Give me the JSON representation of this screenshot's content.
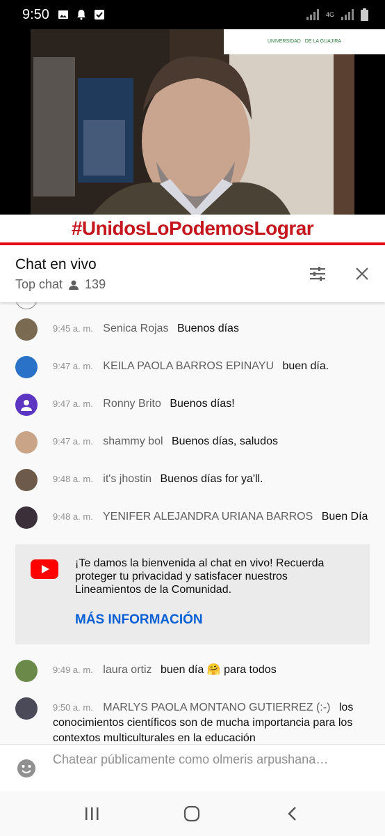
{
  "status_bar": {
    "time": "9:50",
    "network": "4G"
  },
  "video": {
    "hashtag": "#UnidosLoPodemosLograr",
    "logo_line1": "UNIVERSIDAD",
    "logo_line2": "DE LA GUAJIRA"
  },
  "chat_header": {
    "title": "Chat en vivo",
    "mode": "Top chat",
    "viewers": "139"
  },
  "messages": [
    {
      "time": "9:45 a. m.",
      "author": "Senica Rojas",
      "text": "Buenos días",
      "avatar_color": "#7a6a52"
    },
    {
      "time": "9:47 a. m.",
      "author": "KEILA PAOLA BARROS EPINAYU",
      "text": "buen día.",
      "avatar_color": "#2a72c8"
    },
    {
      "time": "9:47 a. m.",
      "author": "Ronny Brito",
      "text": "Buenos días!",
      "avatar_color": "#5c35c2"
    },
    {
      "time": "9:47 a. m.",
      "author": "shammy bol",
      "text": "Buenos días, saludos",
      "avatar_color": "#c9a487"
    },
    {
      "time": "9:48 a. m.",
      "author": "it's jhostin",
      "text": "Buenos días for ya'll.",
      "avatar_color": "#6d5a4a"
    },
    {
      "time": "9:48 a. m.",
      "author": "YENIFER ALEJANDRA URIANA BARROS",
      "text": "Buen Día",
      "avatar_color": "#3b2f3a"
    },
    {
      "time": "9:49 a. m.",
      "author": "laura ortiz",
      "text": "buen día",
      "emoji": "🤗",
      "text2": "para todos",
      "avatar_color": "#6b8a4a"
    },
    {
      "time": "9:50 a. m.",
      "author": "MARLYS PAOLA MONTANO GUTIERREZ (:-)",
      "text": "los conocimientos científicos son de mucha importancia para los contextos multiculturales en la educación",
      "avatar_color": "#4a4a58"
    }
  ],
  "welcome": {
    "text": "¡Te damos la bienvenida al chat en vivo! Recuerda proteger tu privacidad y satisfacer nuestros Lineamientos de la Comunidad.",
    "link": "MÁS INFORMACIÓN"
  },
  "input": {
    "placeholder": "Chatear públicamente como olmeris arpushana…"
  },
  "colors": {
    "link": "#065fd4",
    "brand_red": "#ff0000",
    "banner_red": "#c4161c"
  }
}
